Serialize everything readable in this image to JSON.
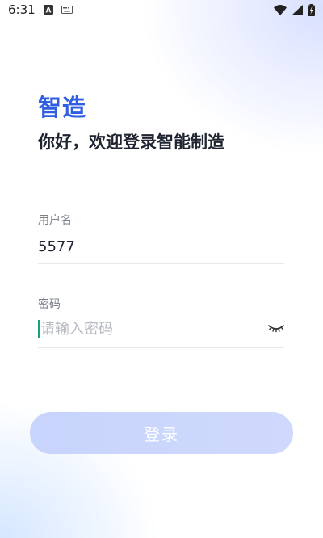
{
  "status_bar": {
    "time": "6:31"
  },
  "app": {
    "brand": "智造",
    "welcome": "你好，欢迎登录智能制造"
  },
  "form": {
    "username_label": "用户名",
    "username_value": "5577",
    "password_label": "密码",
    "password_placeholder": "请输入密码",
    "login_label": "登录"
  },
  "colors": {
    "brand_blue": "#2f5fe0",
    "button_bg": "#cad6fc",
    "caret": "#16a37a"
  },
  "icons": {
    "status_left": [
      "notification-a-icon",
      "keyboard-icon"
    ],
    "status_right": [
      "wifi-icon",
      "signal-icon",
      "battery-charging-icon"
    ],
    "password_toggle": "eye-closed-icon"
  }
}
